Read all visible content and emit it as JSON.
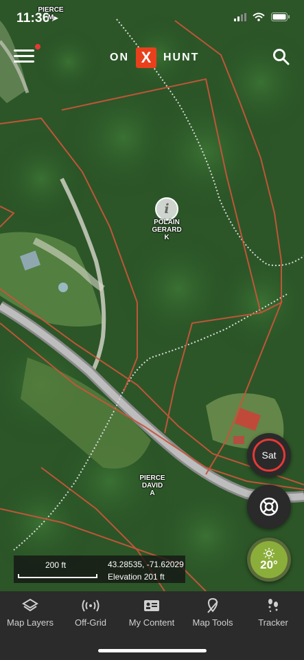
{
  "status_bar": {
    "time": "11:36"
  },
  "header": {
    "logo_left": "ON",
    "logo_mark": "X",
    "logo_right": "HUNT"
  },
  "map": {
    "parcels": [
      {
        "owner": "PIERCE\nM",
        "partial": true
      },
      {
        "owner": "POLAIN\nGERARD\nK"
      },
      {
        "owner": "PIERCE\nDAVID\nA"
      }
    ],
    "info_marker": "i"
  },
  "controls": {
    "basemap_label": "Sat",
    "weather_temp": "20°"
  },
  "scale": {
    "distance": "200 ft",
    "coordinates": "43.28535, -71.62029",
    "elevation": "Elevation 201 ft"
  },
  "nav": [
    {
      "label": "Map Layers",
      "icon": "layers-icon"
    },
    {
      "label": "Off-Grid",
      "icon": "off-grid-signal-icon"
    },
    {
      "label": "My Content",
      "icon": "content-card-icon"
    },
    {
      "label": "Map Tools",
      "icon": "map-tools-icon"
    },
    {
      "label": "Tracker",
      "icon": "tracker-footprints-icon"
    }
  ],
  "colors": {
    "parcel_line": "#c8553a",
    "trail_line": "#d8d8d8",
    "brand_red": "#e8401c",
    "sat_ring": "#e53935",
    "weather_green": "#8bae3a"
  }
}
